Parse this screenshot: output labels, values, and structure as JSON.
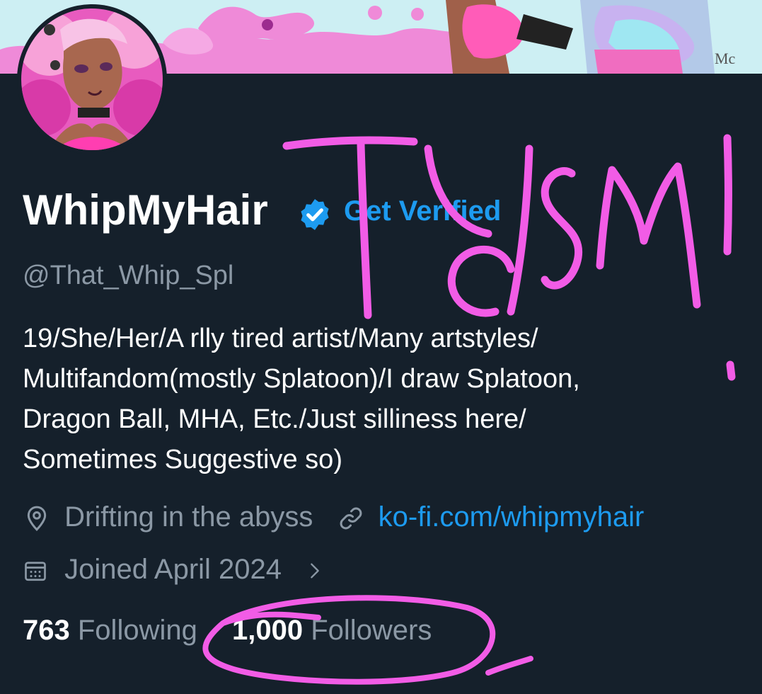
{
  "profile": {
    "display_name": "WhipMyHair",
    "get_verified_label": "Get Verified",
    "handle": "@That_Whip_Spl",
    "bio_lines": [
      "19/She/Her/A rlly tired artist/Many artstyles/",
      "Multifandom(mostly Splatoon)/I draw Splatoon,",
      "Dragon Ball, MHA, Etc./Just silliness here/",
      "Sometimes Suggestive so)"
    ],
    "location": "Drifting in the abyss",
    "website": "ko-fi.com/whipmyhair",
    "joined": "Joined April 2024",
    "following_count": "763",
    "following_label": "Following",
    "followers_count": "1,000",
    "followers_label": "Followers"
  },
  "overlay": {
    "handwritten_text": "TYSM!"
  },
  "colors": {
    "background": "#15202b",
    "accent_blue": "#1d9bf0",
    "secondary_text": "#8b98a5",
    "doodle_pink": "#f25ce6",
    "banner_pink": "#ef8ad8"
  },
  "icons": [
    "verified-badge-icon",
    "location-pin-icon",
    "link-icon",
    "calendar-icon",
    "chevron-right-icon"
  ]
}
